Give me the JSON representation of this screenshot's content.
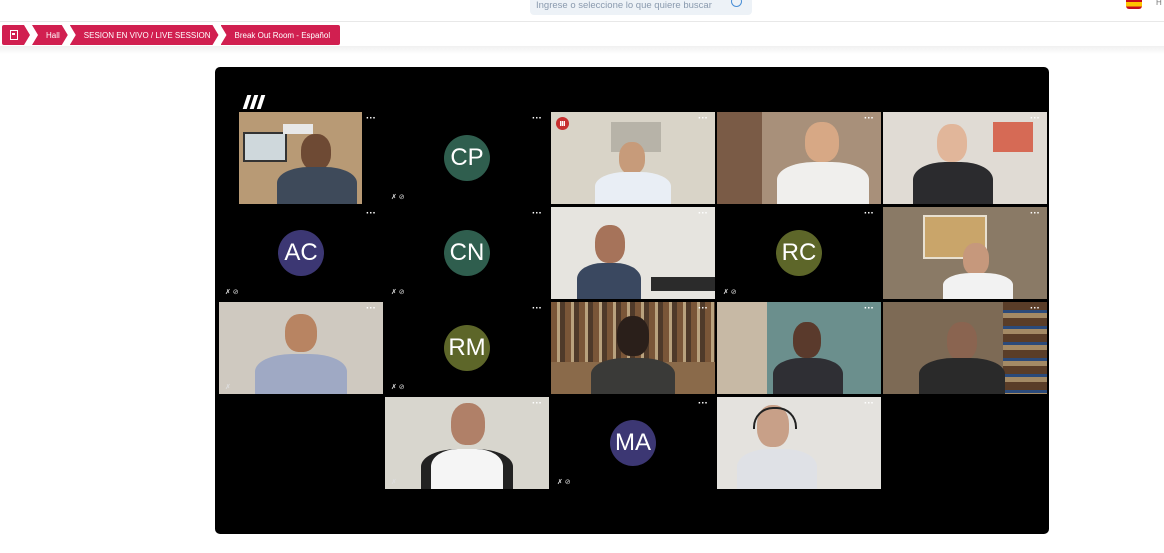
{
  "search": {
    "placeholder": "Ingrese o seleccione lo que quiere buscar"
  },
  "user": {
    "initial": "H"
  },
  "breadcrumb": {
    "items": [
      {
        "label": "Hall"
      },
      {
        "label": "SESION EN VIVO / LIVE SESSION"
      },
      {
        "label": "Break Out Room - Español"
      }
    ]
  },
  "colors": {
    "accent": "#d11f50",
    "meeting_bg": "#000000"
  },
  "participants": [
    {
      "initials": "",
      "type": "video"
    },
    {
      "initials": "CP",
      "type": "avatar",
      "color": "#2f5e4e"
    },
    {
      "initials": "",
      "type": "video",
      "speaking": true
    },
    {
      "initials": "",
      "type": "video"
    },
    {
      "initials": "",
      "type": "video"
    },
    {
      "initials": "AC",
      "type": "avatar",
      "color": "#3c3773"
    },
    {
      "initials": "CN",
      "type": "avatar",
      "color": "#2f5e4e"
    },
    {
      "initials": "",
      "type": "video"
    },
    {
      "initials": "RC",
      "type": "avatar",
      "color": "#5d6629"
    },
    {
      "initials": "",
      "type": "video"
    },
    {
      "initials": "",
      "type": "video"
    },
    {
      "initials": "RM",
      "type": "avatar",
      "color": "#5d6629"
    },
    {
      "initials": "",
      "type": "video"
    },
    {
      "initials": "",
      "type": "video"
    },
    {
      "initials": "",
      "type": "video"
    },
    {
      "initials": "",
      "type": "video"
    },
    {
      "initials": "MA",
      "type": "avatar",
      "color": "#3c3773"
    },
    {
      "initials": "",
      "type": "video"
    }
  ],
  "icons": {
    "more": "more-options-icon",
    "mic_off": "mic-off-icon",
    "cam_off": "camera-off-icon",
    "search": "search-icon"
  }
}
